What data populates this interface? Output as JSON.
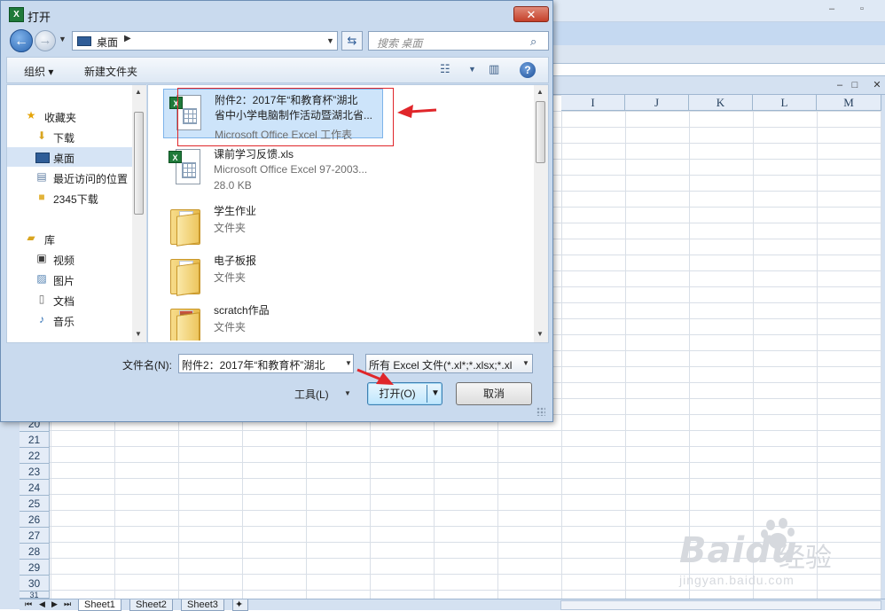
{
  "dialog": {
    "title": "打开",
    "address": {
      "location": "桌面"
    },
    "search": {
      "placeholder": "搜索 桌面"
    },
    "toolbar": {
      "organize": "组织 ▾",
      "new_folder": "新建文件夹"
    },
    "nav_pane": {
      "favorites_header": "收藏夹",
      "favorites": [
        {
          "label": "下载",
          "icon": "download-folder-icon"
        },
        {
          "label": "桌面",
          "icon": "desktop-icon",
          "selected": true
        },
        {
          "label": "最近访问的位置",
          "icon": "recent-places-icon"
        },
        {
          "label": "2345下载",
          "icon": "folder-icon"
        }
      ],
      "libraries_header": "库",
      "libraries": [
        {
          "label": "视频",
          "icon": "video-library-icon"
        },
        {
          "label": "图片",
          "icon": "picture-library-icon"
        },
        {
          "label": "文档",
          "icon": "document-library-icon"
        },
        {
          "label": "音乐",
          "icon": "music-library-icon"
        }
      ]
    },
    "files": [
      {
        "name_line1": "附件2：2017年“和教育杯”湖北",
        "name_line2": "省中小学电脑制作活动暨湖北省...",
        "detail": "Microsoft Office Excel 工作表",
        "type": "excel",
        "selected": true
      },
      {
        "name_line1": "课前学习反馈.xls",
        "detail": "Microsoft Office Excel 97-2003...",
        "detail2": "28.0 KB",
        "type": "excel-legacy"
      },
      {
        "name_line1": "学生作业",
        "detail": "文件夹",
        "type": "folder"
      },
      {
        "name_line1": "电子板报",
        "detail": "文件夹",
        "type": "folder"
      },
      {
        "name_line1": "scratch作品",
        "detail": "文件夹",
        "type": "folder"
      }
    ],
    "filename_label": "文件名(N):",
    "filename_value": "附件2：2017年“和教育杯”湖北",
    "filetype_value": "所有 Excel 文件(*.xl*;*.xlsx;*.xl",
    "tools_label": "工具(L)",
    "open_label": "打开(O)",
    "cancel_label": "取消"
  },
  "excel": {
    "column_headers": [
      "I",
      "J",
      "K",
      "L",
      "M"
    ],
    "row_numbers": [
      "20",
      "21",
      "22",
      "23",
      "24",
      "25",
      "26",
      "27",
      "28",
      "29",
      "30",
      "31"
    ],
    "sheet_tabs": [
      "Sheet1",
      "Sheet2",
      "Sheet3"
    ]
  },
  "watermark": {
    "logo": "Baidu",
    "text": "经验",
    "url": "jingyan.baidu.com"
  },
  "colors": {
    "annotation_red": "#e0262a",
    "selection_blue": "#cde4fa",
    "excel_green": "#1f7a3a"
  }
}
